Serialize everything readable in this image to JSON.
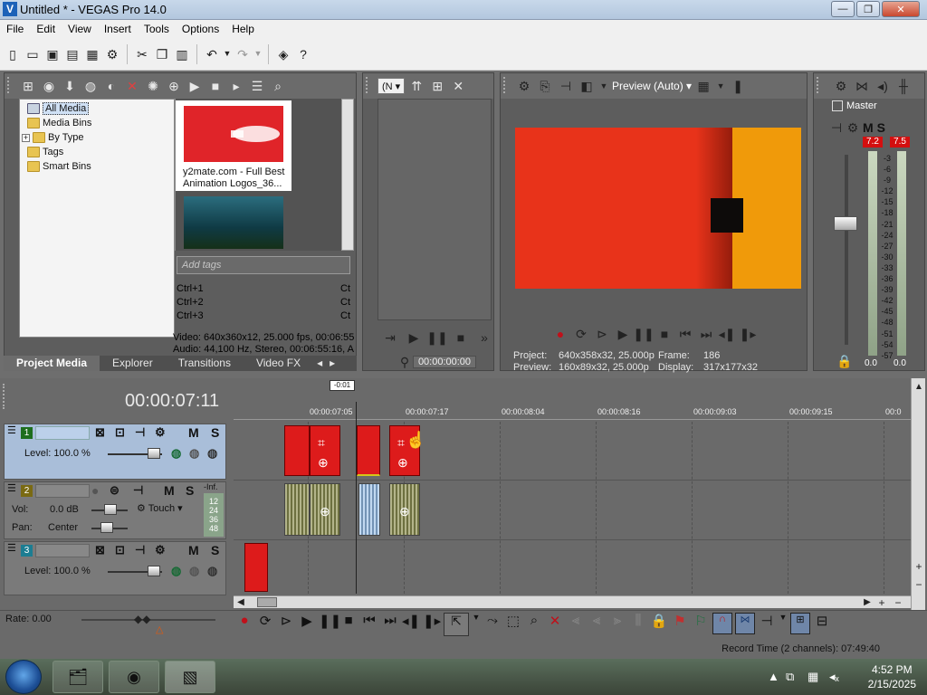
{
  "window": {
    "title": "Untitled * - VEGAS Pro 14.0",
    "logo_glyph": "V",
    "controls": {
      "minimize": "—",
      "maximize": "❐",
      "close": "✕"
    }
  },
  "menu": [
    "File",
    "Edit",
    "View",
    "Insert",
    "Tools",
    "Options",
    "Help"
  ],
  "project_media": {
    "tree": [
      "All Media",
      "Media Bins",
      "By Type",
      "Tags",
      "Smart Bins"
    ],
    "expander": "+",
    "thumb1_caption": "y2mate.com - Full Best Animation Logos_36...",
    "tags_placeholder": "Add tags",
    "shortcuts": [
      {
        "key": "Ctrl+1",
        "right": "Ct"
      },
      {
        "key": "Ctrl+2",
        "right": "Ct"
      },
      {
        "key": "Ctrl+3",
        "right": "Ct"
      }
    ],
    "info_video": "Video: 640x360x12, 25.000 fps, 00:06:55",
    "info_audio": "Audio: 44,100 Hz, Stereo, 00:06:55:16, A"
  },
  "tabs": [
    "Project Media",
    "Explorer",
    "Transitions",
    "Video FX"
  ],
  "trimmer": {
    "mode_short": "(N",
    "time": "00:00:00:00"
  },
  "preview": {
    "mode": "Preview (Auto)",
    "project_label": "Project:",
    "project_value": "640x358x32, 25.000p",
    "frame_label": "Frame:",
    "frame_value": "186",
    "preview_label": "Preview:",
    "preview_value": "160x89x32, 25.000p",
    "display_label": "Display:",
    "display_value": "317x177x32"
  },
  "master": {
    "label": "Master",
    "peak_left": "7.2",
    "peak_right": "7.5",
    "scale": [
      "3",
      "6",
      "9",
      "12",
      "15",
      "18",
      "21",
      "24",
      "27",
      "30",
      "33",
      "36",
      "39",
      "42",
      "45",
      "48",
      "51",
      "54",
      "57"
    ],
    "bottom_left": "0.0",
    "bottom_right": "0.0"
  },
  "timeline": {
    "timecode": "00:00:07:11",
    "loop_flag": "-0:01",
    "ruler": [
      "00:00:07:05",
      "00:00:07:17",
      "00:00:08:04",
      "00:00:08:16",
      "00:00:09:03",
      "00:00:09:15",
      "00:0"
    ],
    "track1": {
      "num": "1",
      "level": "Level: 100.0 %"
    },
    "track2": {
      "num": "2",
      "vol_label": "Vol:",
      "vol_value": "0.0 dB",
      "pan_label": "Pan:",
      "pan_value": "Center",
      "touch": "Touch",
      "meter": [
        "-Inf.",
        "12",
        "24",
        "36",
        "48"
      ]
    },
    "track3": {
      "num": "3",
      "level": "Level: 100.0 %"
    },
    "mute": "M",
    "solo": "S"
  },
  "transport": {
    "rate": "Rate: 0.00",
    "record_time": "Record Time (2 channels): 07:49:40"
  },
  "taskbar": {
    "time": "4:52 PM",
    "date": "2/15/2025"
  }
}
